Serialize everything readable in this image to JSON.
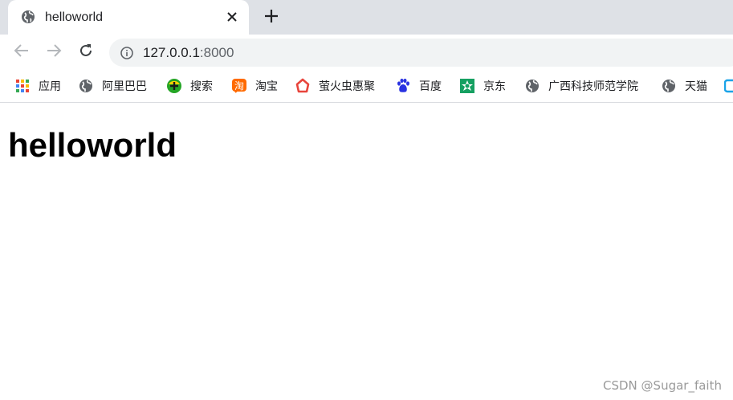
{
  "tab": {
    "title": "helloworld",
    "favicon": "globe-icon",
    "close": "close-icon"
  },
  "new_tab": "plus-icon",
  "toolbar": {
    "back": "back-arrow-icon",
    "forward": "forward-arrow-icon",
    "reload": "reload-icon",
    "url_host": "127.0.0.1",
    "url_port": ":8000",
    "site_info": "info-icon"
  },
  "bookmarks": [
    {
      "label": "应用",
      "icon": "apps-grid-icon"
    },
    {
      "label": "阿里巴巴",
      "icon": "globe-icon"
    },
    {
      "label": "搜索",
      "icon": "search-360-icon"
    },
    {
      "label": "淘宝",
      "icon": "taobao-icon"
    },
    {
      "label": "萤火虫惠聚",
      "icon": "firefly-icon"
    },
    {
      "label": "百度",
      "icon": "baidu-paw-icon"
    },
    {
      "label": "京东",
      "icon": "jd-icon"
    },
    {
      "label": "广西科技师范学院",
      "icon": "globe-icon"
    },
    {
      "label": "天猫",
      "icon": "globe-icon"
    }
  ],
  "page": {
    "heading": "helloworld"
  },
  "watermark": "CSDN @Sugar_faith",
  "colors": {
    "tabstrip_bg": "#dee1e6",
    "omnibox_bg": "#f1f3f4",
    "icon_gray": "#5f6368",
    "taobao_orange": "#ff6a00",
    "firefly_red": "#e8453c",
    "baidu_blue": "#2932e1",
    "jd_green": "#15a061"
  }
}
